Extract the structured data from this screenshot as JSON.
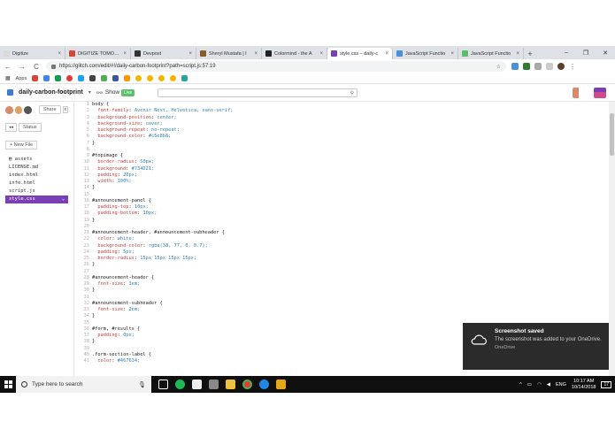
{
  "browser": {
    "tabs": [
      {
        "label": "Digitize",
        "color": "#d9d9d9",
        "active": false
      },
      {
        "label": "DIGITIZE TOMORR",
        "color": "#d44638",
        "active": false
      },
      {
        "label": "Devpost",
        "color": "#333333",
        "active": false
      },
      {
        "label": "Sheryl Mustafa | I",
        "color": "#8b5a2b",
        "active": false
      },
      {
        "label": "Colormind - the A",
        "color": "#222222",
        "active": false
      },
      {
        "label": "style.css – daily-c",
        "color": "#7b3fb5",
        "active": true
      },
      {
        "label": "JavaScript Functio",
        "color": "#4a90d9",
        "active": false
      },
      {
        "label": "JavaScript Functio",
        "color": "#5bc06a",
        "active": false
      }
    ],
    "tab_close": "×",
    "new_tab": "+",
    "window_controls": {
      "minimize": "–",
      "maximize": "❐",
      "close": "✕"
    },
    "nav": {
      "back": "←",
      "forward": "→",
      "reload": "C"
    },
    "url": "https://glitch.com/edit/#!/daily-carbon-footprint?path=script.js:57:19",
    "star": "☆",
    "menu": "⋮",
    "bookmarks_label": "Apps"
  },
  "glitch": {
    "project_name": "daily-carbon-footprint",
    "dropdown": "▾",
    "show_label": "Show",
    "live_badge": "Live",
    "share_label": "Share",
    "close_glyph": "x",
    "status_icon": "◂◂",
    "status_label": "Status",
    "new_file_label": "+ New File",
    "files": [
      {
        "name": "assets",
        "active": false
      },
      {
        "name": "LICENSE.md",
        "active": false
      },
      {
        "name": "index.html",
        "active": false
      },
      {
        "name": "info.html",
        "active": false
      },
      {
        "name": "script.js",
        "active": false
      },
      {
        "name": "style.css",
        "active": true
      }
    ],
    "active_file_chevron": "⌄"
  },
  "editor": {
    "lines": [
      {
        "n": "1",
        "t": "sel",
        "s": "body {"
      },
      {
        "n": "2",
        "t": "decl",
        "p": "font-family",
        "v": "Avenir Next, Helvetica, sans-serif;"
      },
      {
        "n": "3",
        "t": "decl",
        "p": "background-position",
        "v": "center;"
      },
      {
        "n": "4",
        "t": "decl",
        "p": "background-size",
        "v": "cover;"
      },
      {
        "n": "5",
        "t": "decl",
        "p": "background-repeat",
        "v": "no-repeat;"
      },
      {
        "n": "6",
        "t": "decl",
        "p": "background-color",
        "v": "#c5e8b8;"
      },
      {
        "n": "7",
        "t": "sel",
        "s": "}"
      },
      {
        "n": "8",
        "t": "blank",
        "s": ""
      },
      {
        "n": "9",
        "t": "sel",
        "s": "#topimage {"
      },
      {
        "n": "10",
        "t": "decl",
        "p": "border-radius",
        "v": "50px;"
      },
      {
        "n": "11",
        "t": "decl",
        "p": "background",
        "v": "#734D21;"
      },
      {
        "n": "12",
        "t": "decl",
        "p": "padding",
        "v": "20px;"
      },
      {
        "n": "13",
        "t": "decl",
        "p": "width",
        "v": "100%;"
      },
      {
        "n": "14",
        "t": "sel",
        "s": "}"
      },
      {
        "n": "15",
        "t": "blank",
        "s": ""
      },
      {
        "n": "16",
        "t": "sel",
        "s": "#announcement-panel {"
      },
      {
        "n": "17",
        "t": "decl",
        "p": "padding-top",
        "v": "10px;"
      },
      {
        "n": "18",
        "t": "decl",
        "p": "padding-bottom",
        "v": "10px;"
      },
      {
        "n": "19",
        "t": "sel",
        "s": "}"
      },
      {
        "n": "20",
        "t": "blank",
        "s": ""
      },
      {
        "n": "21",
        "t": "sel",
        "s": "#announcement-header, #announcement-subheader {"
      },
      {
        "n": "22",
        "t": "decl",
        "p": "color",
        "v": "white;"
      },
      {
        "n": "23",
        "t": "decl",
        "p": "background-color",
        "v": "rgba(38, 77, 0, 0.7);"
      },
      {
        "n": "24",
        "t": "decl",
        "p": "padding",
        "v": "5px;"
      },
      {
        "n": "25",
        "t": "decl",
        "p": "border-radius",
        "v": "15px 15px 15px 15px;"
      },
      {
        "n": "26",
        "t": "sel",
        "s": "}"
      },
      {
        "n": "27",
        "t": "blank",
        "s": ""
      },
      {
        "n": "28",
        "t": "sel",
        "s": "#announcement-header {"
      },
      {
        "n": "29",
        "t": "decl",
        "p": "font-size",
        "v": "3em;"
      },
      {
        "n": "30",
        "t": "sel",
        "s": "}"
      },
      {
        "n": "31",
        "t": "blank",
        "s": ""
      },
      {
        "n": "32",
        "t": "sel",
        "s": "#announcement-subheader {"
      },
      {
        "n": "33",
        "t": "decl",
        "p": "font-size",
        "v": "2em;"
      },
      {
        "n": "34",
        "t": "sel",
        "s": "}"
      },
      {
        "n": "35",
        "t": "blank",
        "s": ""
      },
      {
        "n": "36",
        "t": "sel",
        "s": "#form, #results {"
      },
      {
        "n": "37",
        "t": "decl",
        "p": "padding",
        "v": "0px;"
      },
      {
        "n": "38",
        "t": "sel",
        "s": "}"
      },
      {
        "n": "39",
        "t": "blank",
        "s": ""
      },
      {
        "n": "40",
        "t": "sel",
        "s": ".form-section-label {"
      },
      {
        "n": "41",
        "t": "decl",
        "p": "color",
        "v": "#467634;"
      }
    ]
  },
  "toast": {
    "title": "Screenshot saved",
    "message": "The screenshot was added to your OneDrive.",
    "source": "OneDrive"
  },
  "taskbar": {
    "search_placeholder": "Type here to search",
    "language": "ENG",
    "time": "10:17 AM",
    "date": "10/14/2018",
    "notifications": "17"
  },
  "colors": {
    "accent": "#7b3fb5",
    "live": "#5bc06a",
    "property": "#c83c3c",
    "value": "#2f7fb5"
  }
}
